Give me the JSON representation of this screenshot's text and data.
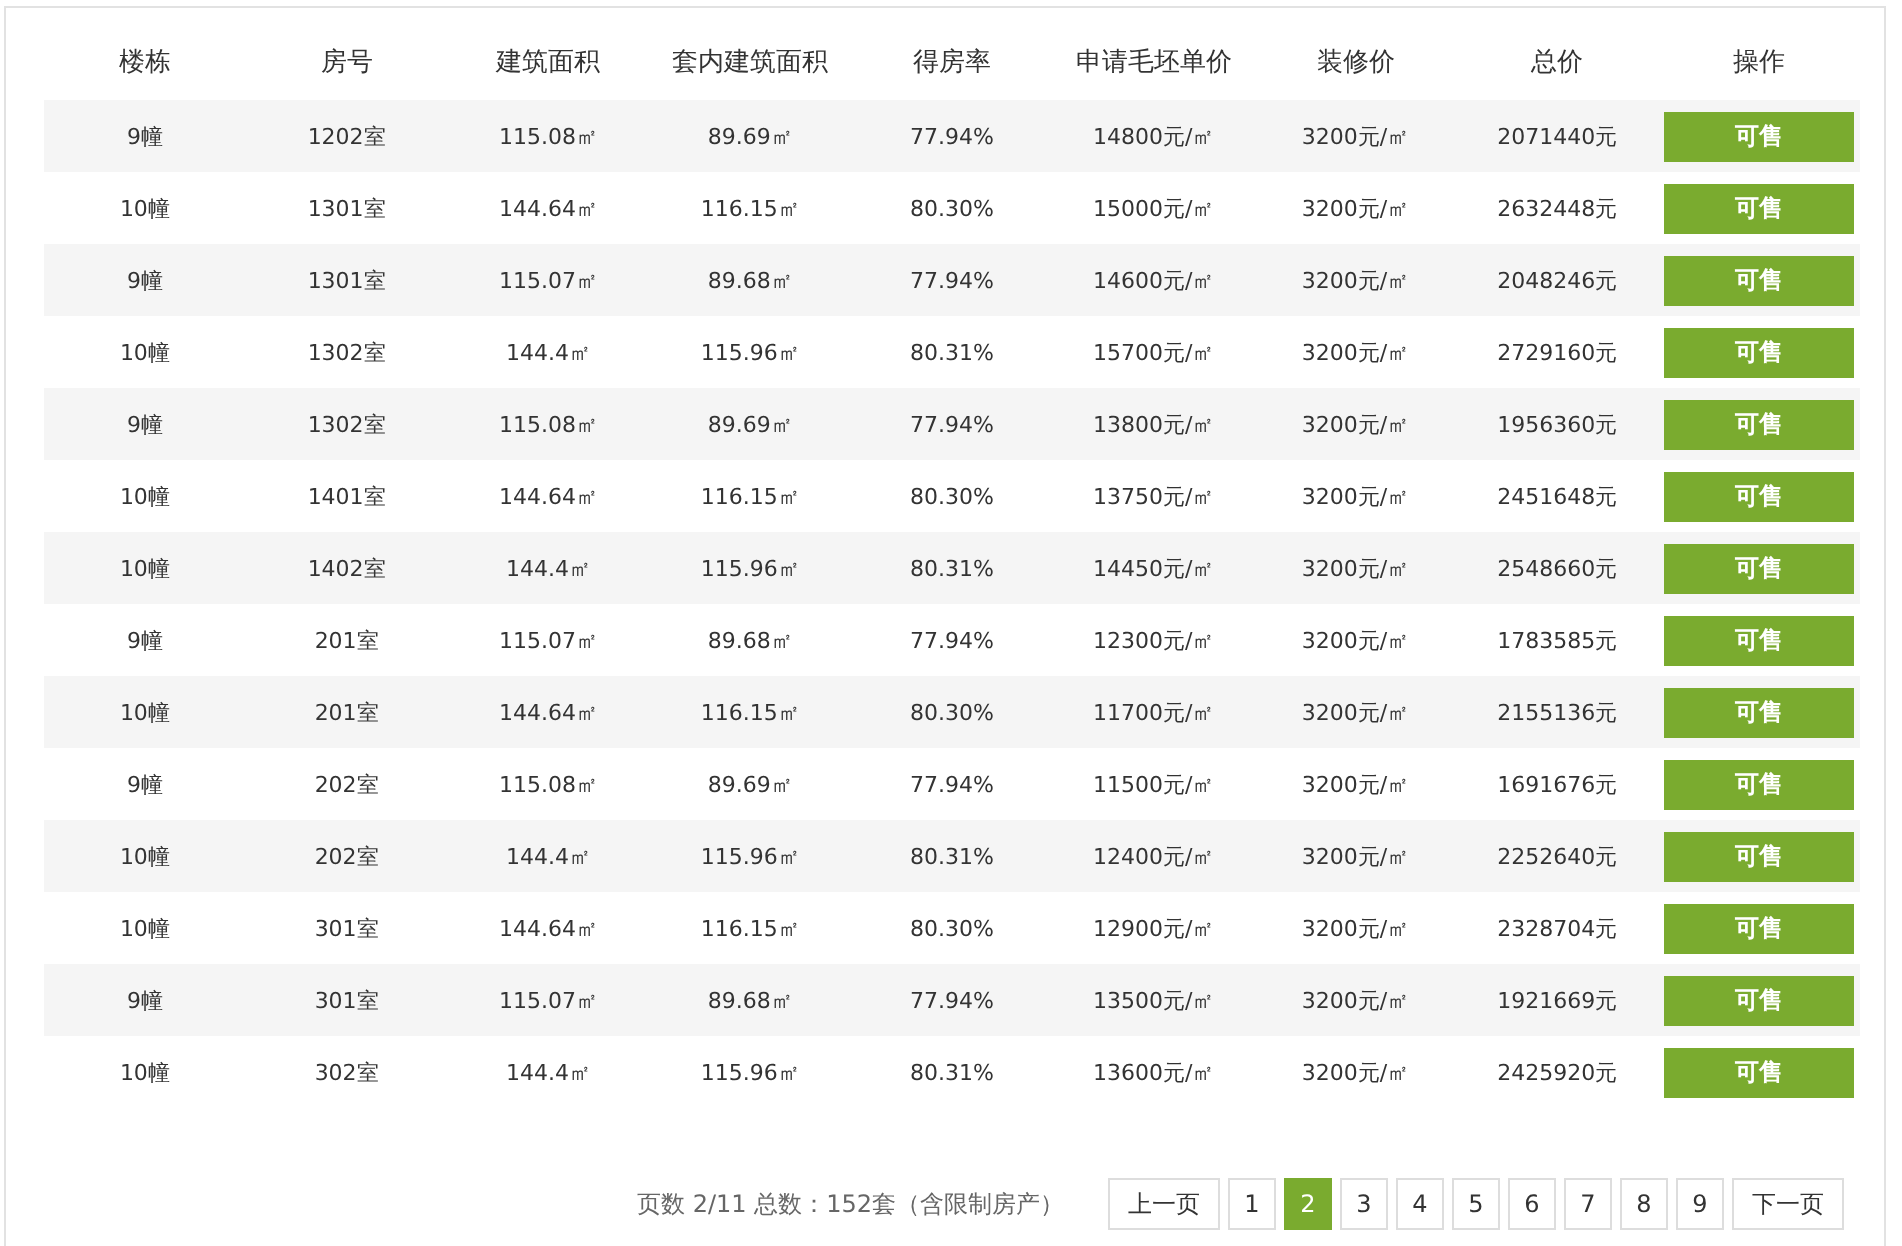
{
  "table": {
    "columns": [
      "楼栋",
      "房号",
      "建筑面积",
      "套内建筑面积",
      "得房率",
      "申请毛坯单价",
      "装修价",
      "总价",
      "操作"
    ],
    "rows": [
      {
        "cells": [
          "9幢",
          "1202室",
          "115.08㎡",
          "89.69㎡",
          "77.94%",
          "14800元/㎡",
          "3200元/㎡",
          "2071440元"
        ],
        "action": "可售"
      },
      {
        "cells": [
          "10幢",
          "1301室",
          "144.64㎡",
          "116.15㎡",
          "80.30%",
          "15000元/㎡",
          "3200元/㎡",
          "2632448元"
        ],
        "action": "可售"
      },
      {
        "cells": [
          "9幢",
          "1301室",
          "115.07㎡",
          "89.68㎡",
          "77.94%",
          "14600元/㎡",
          "3200元/㎡",
          "2048246元"
        ],
        "action": "可售"
      },
      {
        "cells": [
          "10幢",
          "1302室",
          "144.4㎡",
          "115.96㎡",
          "80.31%",
          "15700元/㎡",
          "3200元/㎡",
          "2729160元"
        ],
        "action": "可售"
      },
      {
        "cells": [
          "9幢",
          "1302室",
          "115.08㎡",
          "89.69㎡",
          "77.94%",
          "13800元/㎡",
          "3200元/㎡",
          "1956360元"
        ],
        "action": "可售"
      },
      {
        "cells": [
          "10幢",
          "1401室",
          "144.64㎡",
          "116.15㎡",
          "80.30%",
          "13750元/㎡",
          "3200元/㎡",
          "2451648元"
        ],
        "action": "可售"
      },
      {
        "cells": [
          "10幢",
          "1402室",
          "144.4㎡",
          "115.96㎡",
          "80.31%",
          "14450元/㎡",
          "3200元/㎡",
          "2548660元"
        ],
        "action": "可售"
      },
      {
        "cells": [
          "9幢",
          "201室",
          "115.07㎡",
          "89.68㎡",
          "77.94%",
          "12300元/㎡",
          "3200元/㎡",
          "1783585元"
        ],
        "action": "可售"
      },
      {
        "cells": [
          "10幢",
          "201室",
          "144.64㎡",
          "116.15㎡",
          "80.30%",
          "11700元/㎡",
          "3200元/㎡",
          "2155136元"
        ],
        "action": "可售"
      },
      {
        "cells": [
          "9幢",
          "202室",
          "115.08㎡",
          "89.69㎡",
          "77.94%",
          "11500元/㎡",
          "3200元/㎡",
          "1691676元"
        ],
        "action": "可售"
      },
      {
        "cells": [
          "10幢",
          "202室",
          "144.4㎡",
          "115.96㎡",
          "80.31%",
          "12400元/㎡",
          "3200元/㎡",
          "2252640元"
        ],
        "action": "可售"
      },
      {
        "cells": [
          "10幢",
          "301室",
          "144.64㎡",
          "116.15㎡",
          "80.30%",
          "12900元/㎡",
          "3200元/㎡",
          "2328704元"
        ],
        "action": "可售"
      },
      {
        "cells": [
          "9幢",
          "301室",
          "115.07㎡",
          "89.68㎡",
          "77.94%",
          "13500元/㎡",
          "3200元/㎡",
          "1921669元"
        ],
        "action": "可售"
      },
      {
        "cells": [
          "10幢",
          "302室",
          "144.4㎡",
          "115.96㎡",
          "80.31%",
          "13600元/㎡",
          "3200元/㎡",
          "2425920元"
        ],
        "action": "可售"
      }
    ]
  },
  "pagination": {
    "info": "页数 2/11 总数：152套（含限制房产）",
    "prev": "上一页",
    "pages": [
      {
        "label": "1",
        "selected": false
      },
      {
        "label": "2",
        "selected": true
      },
      {
        "label": "3",
        "selected": false
      },
      {
        "label": "4",
        "selected": false
      },
      {
        "label": "5",
        "selected": false
      },
      {
        "label": "6",
        "selected": false
      },
      {
        "label": "7",
        "selected": false
      },
      {
        "label": "8",
        "selected": false
      },
      {
        "label": "9",
        "selected": false
      }
    ],
    "next": "下一页"
  }
}
